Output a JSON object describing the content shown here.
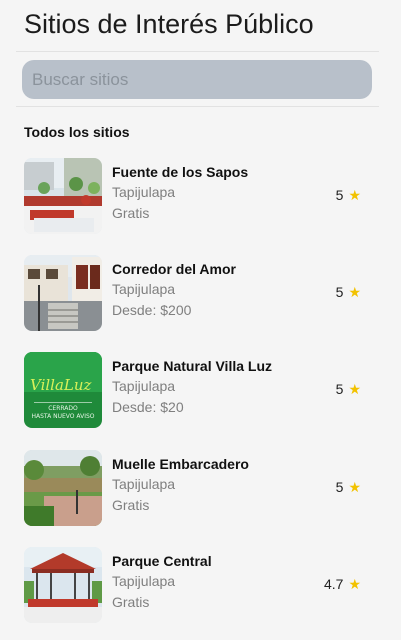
{
  "header": {
    "title": "Sitios de Interés Público"
  },
  "search": {
    "placeholder": "Buscar sitios",
    "value": ""
  },
  "section": {
    "title": "Todos los sitios"
  },
  "sites": [
    {
      "name": "Fuente de los Sapos",
      "location": "Tapijulapa",
      "price": "Gratis",
      "rating": "5"
    },
    {
      "name": "Corredor del Amor",
      "location": "Tapijulapa",
      "price": "Desde: $200",
      "rating": "5"
    },
    {
      "name": "Parque Natural Villa Luz",
      "location": "Tapijulapa",
      "price": "Desde: $20",
      "rating": "5",
      "logo_text": {
        "brand": "VillaLuz",
        "line1": "CERRADO",
        "line2": "HASTA NUEVO AVISO"
      }
    },
    {
      "name": "Muelle Embarcadero",
      "location": "Tapijulapa",
      "price": "Gratis",
      "rating": "5"
    },
    {
      "name": "Parque Central",
      "location": "Tapijulapa",
      "price": "Gratis",
      "rating": "4.7"
    }
  ],
  "icons": {
    "rating": "star-icon"
  },
  "colors": {
    "star": "#f2c200",
    "search_bg": "#b8c0ca"
  }
}
